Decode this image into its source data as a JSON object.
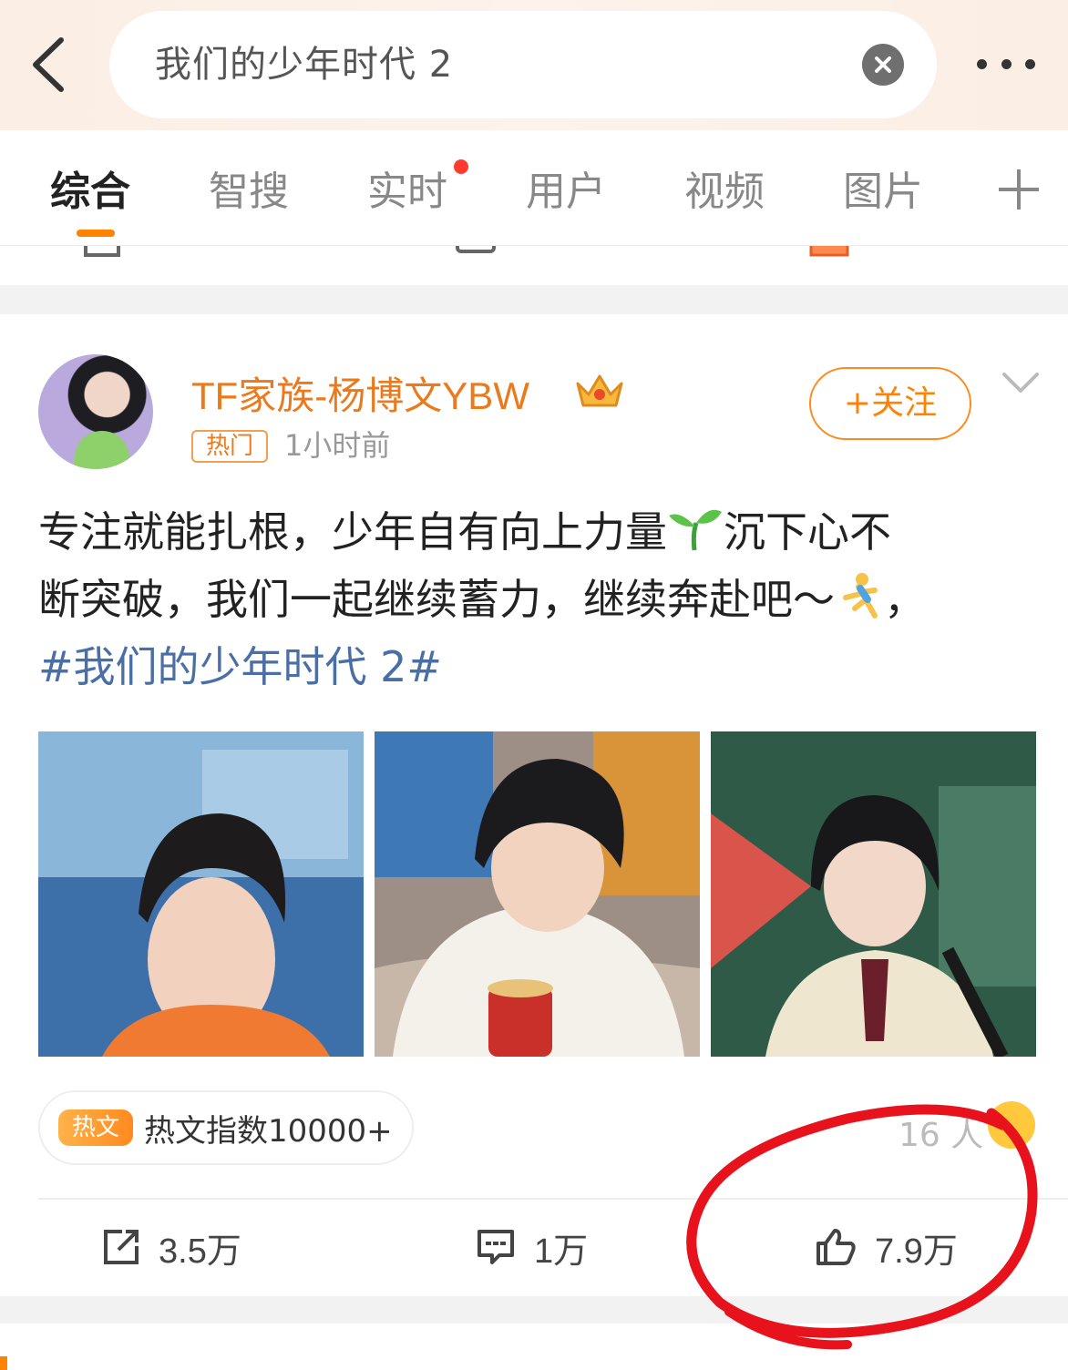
{
  "header": {
    "search_text": "我们的少年时代 2"
  },
  "tabs": [
    {
      "label": "综合"
    },
    {
      "label": "智搜"
    },
    {
      "label": "实时"
    },
    {
      "label": "用户"
    },
    {
      "label": "视频"
    },
    {
      "label": "图片"
    }
  ],
  "post": {
    "username": "TF家族-杨博文YBW",
    "tag": "热门",
    "time": "1小时前",
    "follow_label": "+关注",
    "text_line1": "专注就能扎根，少年自有向上力量",
    "text_line1b": "沉下心不",
    "text_line2": "断突破，我们一起继续蓄力，继续奔赴吧～",
    "text_line2b": "，",
    "hashtag": "#我们的少年时代 2#",
    "hot_badge": "热文",
    "hot_index": "热文指数10000+",
    "readers": "16 人",
    "reposts": "3.5万",
    "comments": "1万",
    "likes": "7.9万"
  },
  "colors": {
    "accent": "#ff8200",
    "username": "#ea7a1b",
    "hashtag": "#4a6fa5",
    "annotation_circle": "#e8121c"
  },
  "icons": [
    "back-arrow-icon",
    "clear-icon",
    "more-icon",
    "plus-icon",
    "crown-icon",
    "chevron-down-icon",
    "sprout-emoji-icon",
    "runner-emoji-icon",
    "repost-icon",
    "comment-icon",
    "like-icon"
  ]
}
